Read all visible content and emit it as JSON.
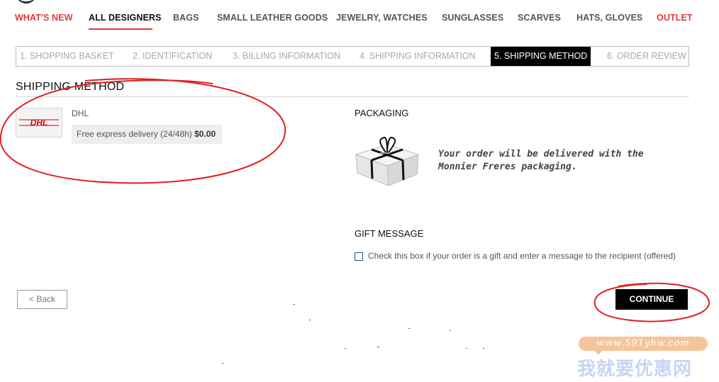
{
  "nav": {
    "items": [
      {
        "label": "WHAT'S NEW"
      },
      {
        "label": "ALL DESIGNERS"
      },
      {
        "label": "BAGS"
      },
      {
        "label": "SMALL LEATHER GOODS"
      },
      {
        "label": "JEWELRY, WATCHES"
      },
      {
        "label": "SUNGLASSES"
      },
      {
        "label": "SCARVES"
      },
      {
        "label": "HATS, GLOVES"
      },
      {
        "label": "OUTLET"
      }
    ],
    "active": "ALL DESIGNERS"
  },
  "steps": [
    {
      "label": "1. SHOPPING BASKET"
    },
    {
      "label": "2. IDENTIFICATION"
    },
    {
      "label": "3. BILLING INFORMATION"
    },
    {
      "label": "4. SHIPPING INFORMATION"
    },
    {
      "label": "5. SHIPPING METHOD",
      "current": true
    },
    {
      "label": "6. ORDER REVIEW"
    }
  ],
  "page_title": "SHIPPING METHOD",
  "shipping": {
    "carrier": "DHL",
    "logo_text": "DHL",
    "option_text": "Free express delivery (24/48h)",
    "option_price": "$0.00"
  },
  "packaging": {
    "title": "PACKAGING",
    "text_line1": "Your order will be delivered with the",
    "text_line2": "Monnier Freres packaging."
  },
  "gift": {
    "title": "GIFT MESSAGE",
    "checkbox_label": "Check this box if your order is a gift and enter a message to the recipient (offered)",
    "checked": false
  },
  "buttons": {
    "back": "< Back",
    "continue": "CONTINUE"
  },
  "watermark": {
    "url": "www.591yhw.com",
    "text": "我就要优惠网"
  },
  "colors": {
    "accent_red": "#e03a3a",
    "annotation_red": "#e02020",
    "dhl_red": "#d40511"
  }
}
